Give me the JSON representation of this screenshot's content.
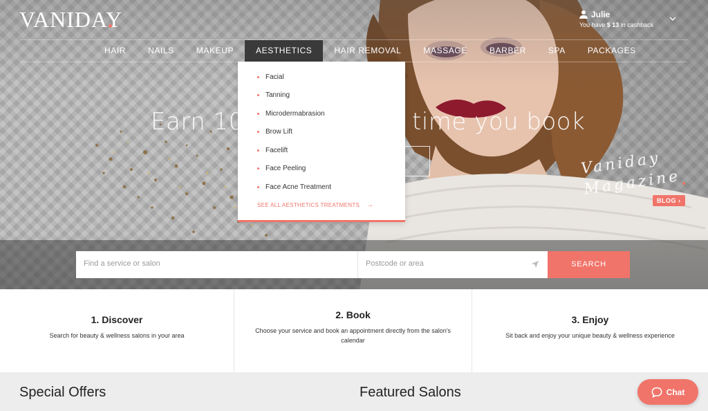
{
  "brand": {
    "logo": "VANIDAY",
    "accent": "#f0746a"
  },
  "user": {
    "name": "Julie",
    "cashback_prefix": "You have ",
    "cashback_amount": "$ 13",
    "cashback_suffix": " in cashback"
  },
  "nav": {
    "items": [
      "HAIR",
      "NAILS",
      "MAKEUP",
      "AESTHETICS",
      "HAIR REMOVAL",
      "MASSAGE",
      "BARBER",
      "SPA",
      "PACKAGES"
    ],
    "active": "AESTHETICS"
  },
  "dropdown": {
    "items": [
      "Facial",
      "Tanning",
      "Microdermabrasion",
      "Brow Lift",
      "Facelift",
      "Face Peeling",
      "Face Acne Treatment"
    ],
    "see_all": "SEE ALL AESTHETICS TREATMENTS"
  },
  "hero": {
    "headline_left": "Earn 10%",
    "headline_right": "time you book",
    "magazine_line1": "Vaniday",
    "magazine_line2": "Magazine",
    "blog_label": "BLOG"
  },
  "search": {
    "service_placeholder": "Find a service or salon",
    "postcode_placeholder": "Postcode or area",
    "button_label": "SEARCH"
  },
  "steps": [
    {
      "title": "1. Discover",
      "text": "Search for beauty & wellness salons in your area"
    },
    {
      "title": "2. Book",
      "text": "Choose your service and book an appointment directly from the salon's calendar"
    },
    {
      "title": "3. Enjoy",
      "text": "Sit back and enjoy your unique beauty & wellness experience"
    }
  ],
  "sections": {
    "special_offers": "Special Offers",
    "featured_salons": "Featured Salons"
  },
  "chat": {
    "label": "Chat"
  }
}
